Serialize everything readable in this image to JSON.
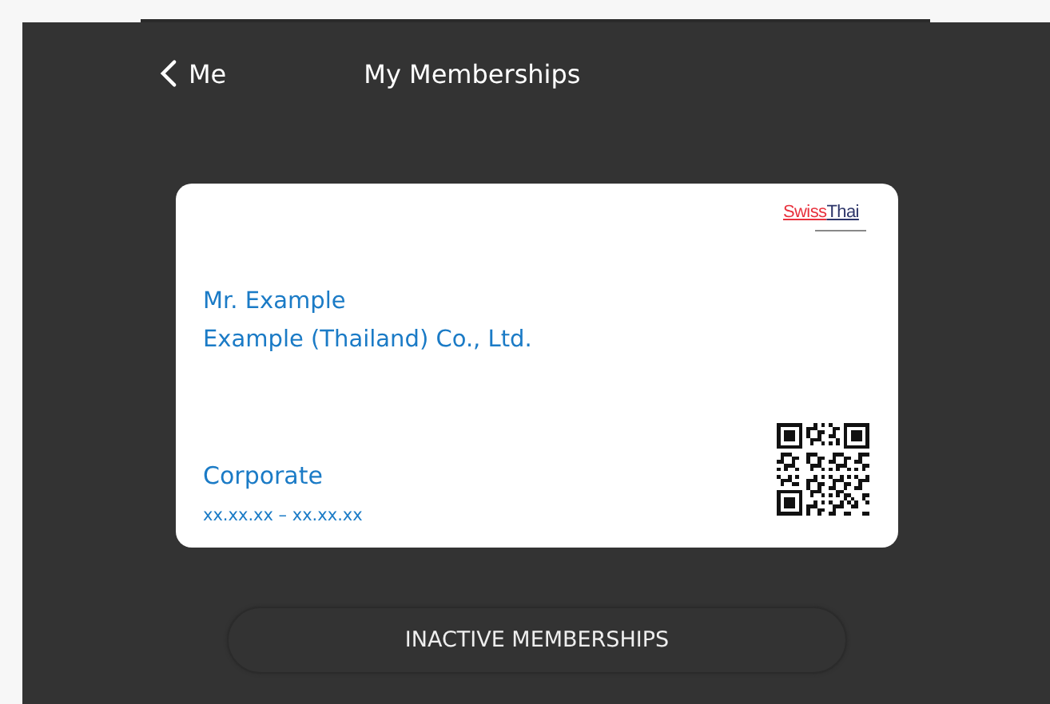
{
  "header": {
    "back_label": "Me",
    "title": "My Memberships"
  },
  "card": {
    "logo": {
      "part_1": "Swiss",
      "part_2": "Thai"
    },
    "member_name": "Mr. Example",
    "company": "Example (Thailand) Co., Ltd.",
    "membership_type": "Corporate",
    "validity": "xx.xx.xx – xx.xx.xx"
  },
  "buttons": [
    "INACTIVE MEMBERSHIPS"
  ]
}
